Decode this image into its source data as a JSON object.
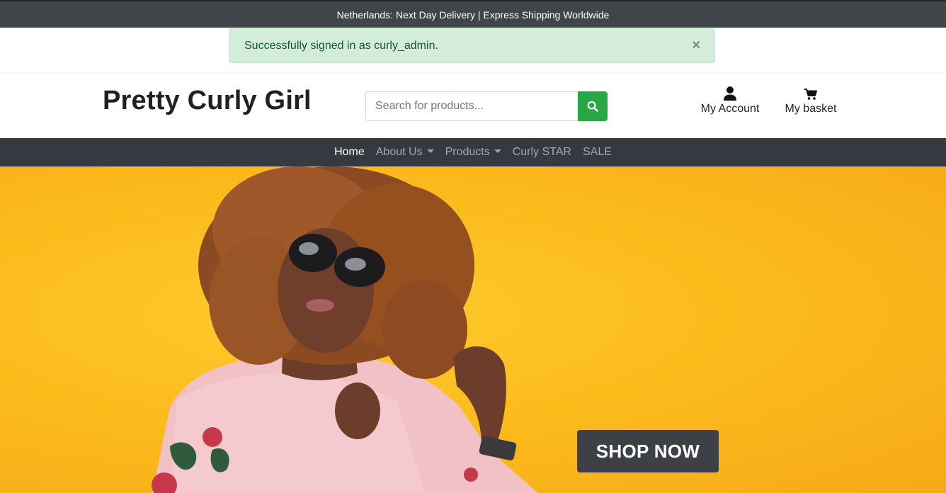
{
  "top_banner": {
    "text": "Netherlands: Next Day Delivery | Express Shipping Worldwide"
  },
  "alert": {
    "message": "Successfully signed in as curly_admin.",
    "close": "×"
  },
  "header": {
    "logo": "Pretty Curly Girl",
    "search_placeholder": "Search for products...",
    "account_label": "My Account",
    "basket_label": "My basket"
  },
  "nav": {
    "items": [
      {
        "label": "Home",
        "active": true
      },
      {
        "label": "About Us",
        "dropdown": true
      },
      {
        "label": "Products",
        "dropdown": true
      },
      {
        "label": "Curly STAR"
      },
      {
        "label": "SALE"
      }
    ]
  },
  "hero": {
    "cta_label": "SHOP NOW",
    "image": "woman-with-curly-hair-and-sunglasses"
  },
  "colors": {
    "banner": "#40454a",
    "alert_bg": "#d4edda",
    "alert_text": "#155724",
    "search_button": "#28a745",
    "navbar": "#343a40",
    "hero_bg": "#fbbc1c",
    "cta_bg": "#3d4145"
  }
}
